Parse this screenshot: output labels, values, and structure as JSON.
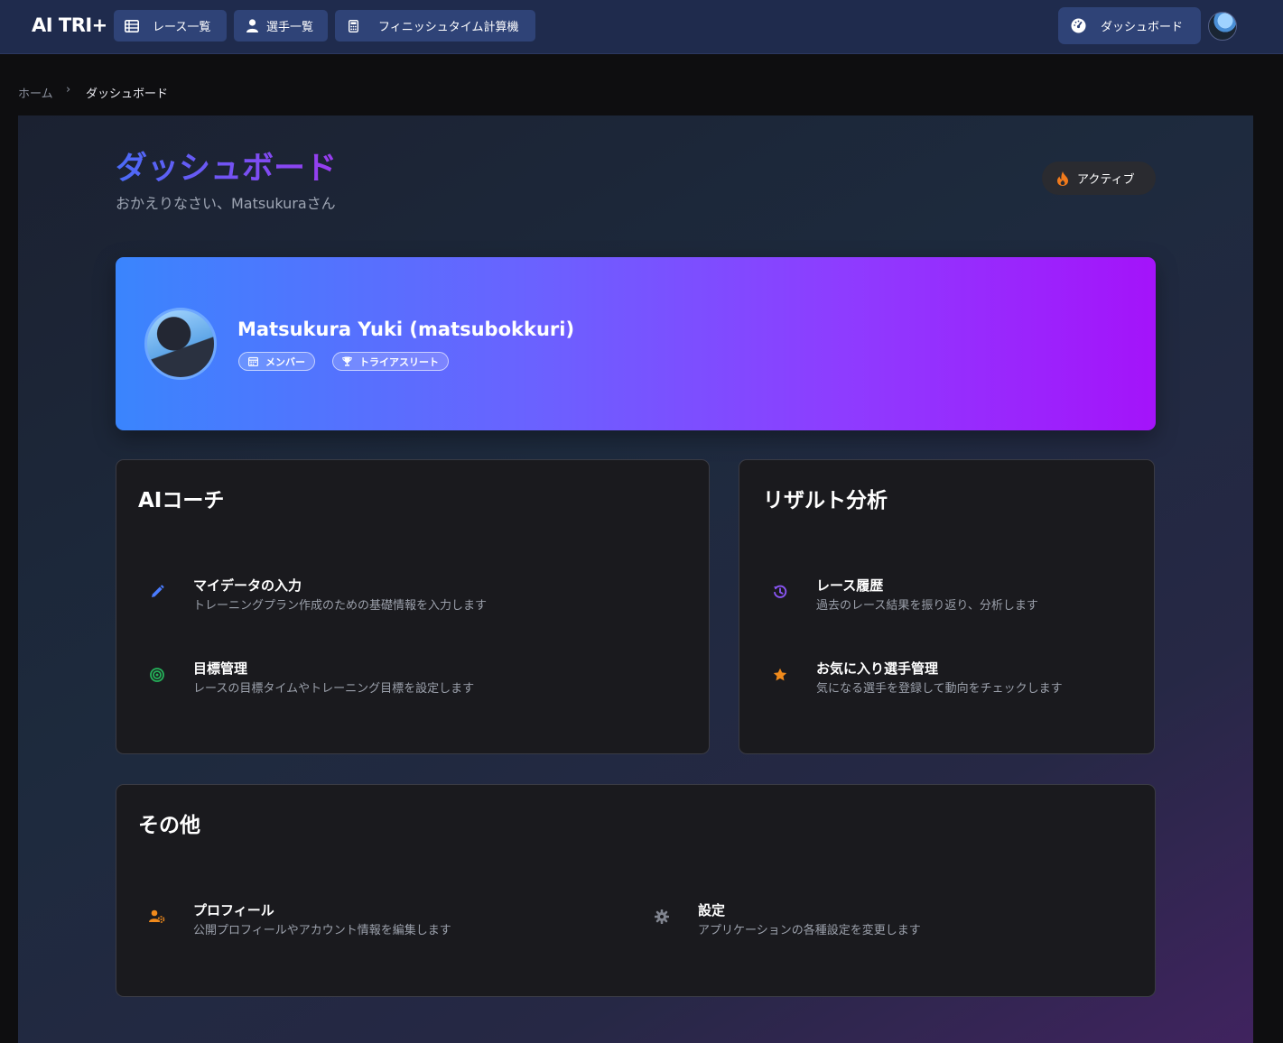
{
  "nav": {
    "brand": "AI TRI+",
    "items": [
      {
        "label": "レース一覧",
        "icon": "table-list-icon"
      },
      {
        "label": "選手一覧",
        "icon": "user-icon"
      },
      {
        "label": "フィニッシュタイム計算機",
        "icon": "calculator-icon"
      }
    ],
    "dashboard_label": "ダッシュボード",
    "dashboard_icon": "gauge-icon"
  },
  "breadcrumb": {
    "home": "ホーム",
    "separator": "›",
    "current": "ダッシュボード"
  },
  "header": {
    "title": "ダッシュボード",
    "subtitle": "おかえりなさい、Matsukuraさん",
    "status_badge": "アクティブ"
  },
  "profile": {
    "name": "Matsukura Yuki (matsubokkuri)",
    "chips": [
      "メンバー",
      "トライアスリート"
    ]
  },
  "cards": {
    "ai_coach": {
      "title": "AIコーチ",
      "items": [
        {
          "title": "マイデータの入力",
          "desc": "トレーニングプラン作成のための基礎情報を入力します",
          "icon": "pencil-icon",
          "color": "#4a7cff"
        },
        {
          "title": "目標管理",
          "desc": "レースの目標タイムやトレーニング目標を設定します",
          "icon": "target-icon",
          "color": "#25b35a"
        }
      ]
    },
    "results": {
      "title": "リザルト分析",
      "items": [
        {
          "title": "レース履歴",
          "desc": "過去のレース結果を振り返り、分析します",
          "icon": "history-icon",
          "color": "#8a55f5"
        },
        {
          "title": "お気に入り選手管理",
          "desc": "気になる選手を登録して動向をチェックします",
          "icon": "star-icon",
          "color": "#f08a1c"
        }
      ]
    },
    "other": {
      "title": "その他",
      "items": [
        {
          "title": "プロフィール",
          "desc": "公開プロフィールやアカウント情報を編集します",
          "icon": "user-gear-icon",
          "color": "#f08a1c"
        },
        {
          "title": "設定",
          "desc": "アプリケーションの各種設定を変更します",
          "icon": "gear-icon",
          "color": "#80848f"
        }
      ]
    }
  },
  "colors": {
    "navbar": "#1f2b4d",
    "nav_button": "#2f4377",
    "accent_start": "#3a85fd",
    "accent_end": "#a413fa",
    "card_bg": "#1a1a1e"
  }
}
